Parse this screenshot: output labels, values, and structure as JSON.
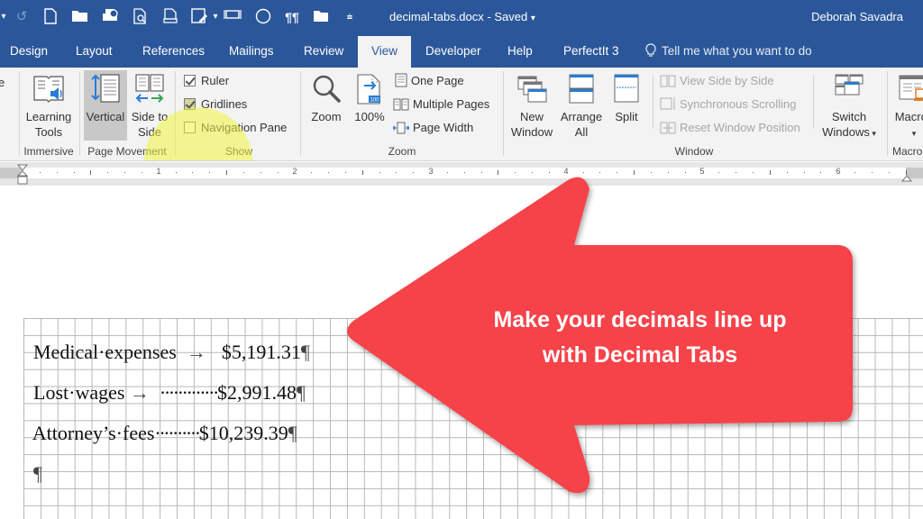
{
  "titlebar": {
    "document_title": "decimal-tabs.docx - Saved",
    "title_dropdown": "▾",
    "user_name": "Deborah Savadra",
    "qat_icons": [
      "dropdown-icon",
      "redo-icon",
      "new-document-icon",
      "open-folder-icon",
      "print-icon",
      "print-preview-icon",
      "page-setup-icon",
      "save-as-icon",
      "fit-page-icon",
      "circle-shape-icon",
      "show-formatting-icon",
      "folder-icon",
      "customize-toolbar-icon"
    ]
  },
  "tabs": [
    {
      "label": "Design"
    },
    {
      "label": "Layout"
    },
    {
      "label": "References"
    },
    {
      "label": "Mailings"
    },
    {
      "label": "Review"
    },
    {
      "label": "View",
      "active": true
    },
    {
      "label": "Developer"
    },
    {
      "label": "Help"
    },
    {
      "label": "PerfectIt 3"
    }
  ],
  "tell_me": "Tell me what you want to do",
  "ribbon": {
    "partial_label": "e",
    "immersive": {
      "label": "Immersive",
      "learning_tools": "Learning Tools"
    },
    "page_movement": {
      "label": "Page Movement",
      "vertical": "Vertical",
      "side_to_side": "Side to Side"
    },
    "show": {
      "label": "Show",
      "ruler": {
        "label": "Ruler",
        "checked": true
      },
      "gridlines": {
        "label": "Gridlines",
        "checked": true
      },
      "navigation_pane": {
        "label": "Navigation Pane",
        "checked": false
      }
    },
    "zoom": {
      "label": "Zoom",
      "zoom": "Zoom",
      "hundred": "100%",
      "one_page": "One Page",
      "multiple_pages": "Multiple Pages",
      "page_width": "Page Width"
    },
    "window": {
      "label": "Window",
      "new_window": "New Window",
      "arrange_all": "Arrange All",
      "split": "Split",
      "view_side_by_side": "View Side by Side",
      "synchronous_scrolling": "Synchronous Scrolling",
      "reset_window_position": "Reset Window Position",
      "switch_windows": "Switch Windows"
    },
    "macros": {
      "label": "Macros",
      "macros": "Macros"
    }
  },
  "ruler": {
    "numbers": [
      "1",
      "2",
      "3",
      "4",
      "5",
      "6"
    ]
  },
  "document": {
    "lines": [
      {
        "label": "Medical·expenses",
        "tab": "  →  ",
        "leader": "",
        "amount": "$5,191.31",
        "mark": "¶"
      },
      {
        "label": "Lost·wages",
        "tab": " →  ",
        "leader": "·············",
        "amount": "$2,991.48",
        "mark": "¶"
      },
      {
        "label": "Attorney’s·fees",
        "tab": "",
        "leader": "··········",
        "amount": "$10,239.39",
        "mark": "¶"
      },
      {
        "label": "",
        "tab": "",
        "leader": "",
        "amount": "",
        "mark": "¶"
      }
    ]
  },
  "callout": {
    "line1": "Make your decimals line up",
    "line2": "with Decimal Tabs",
    "color": "#f64348"
  },
  "colors": {
    "word_blue": "#2b579a",
    "ribbon_bg": "#f3f3f3",
    "highlight": "#f0f53c"
  }
}
